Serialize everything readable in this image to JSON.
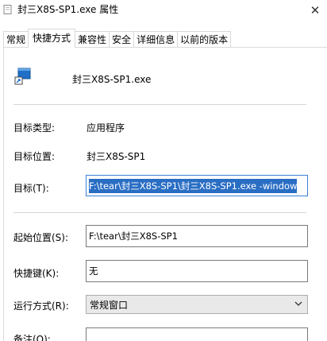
{
  "window": {
    "title": "封三X8S-SP1.exe 属性",
    "close_glyph": "✕"
  },
  "tabs": [
    {
      "label": "常规",
      "active": false
    },
    {
      "label": "快捷方式",
      "active": true
    },
    {
      "label": "兼容性",
      "active": false
    },
    {
      "label": "安全",
      "active": false
    },
    {
      "label": "详细信息",
      "active": false
    },
    {
      "label": "以前的版本",
      "active": false
    }
  ],
  "shortcut": {
    "app_name": "封三X8S-SP1.exe",
    "app_icon": "shortcut-app-icon",
    "target_type_label": "目标类型:",
    "target_type_value": "应用程序",
    "target_location_label": "目标位置:",
    "target_location_value": "封三X8S-SP1",
    "target_label": "目标(T):",
    "target_value": "F:\\tear\\封三X8S-SP1\\封三X8S-SP1.exe -window",
    "start_in_label": "起始位置(S):",
    "start_in_value": "F:\\tear\\封三X8S-SP1",
    "hotkey_label": "快捷键(K):",
    "hotkey_value": "无",
    "run_label": "运行方式(R):",
    "run_value": "常规窗口",
    "comment_label": "备注(O):",
    "comment_value": ""
  },
  "colors": {
    "selection": "#2a6ec4",
    "focus_border": "#3b7fd6"
  }
}
